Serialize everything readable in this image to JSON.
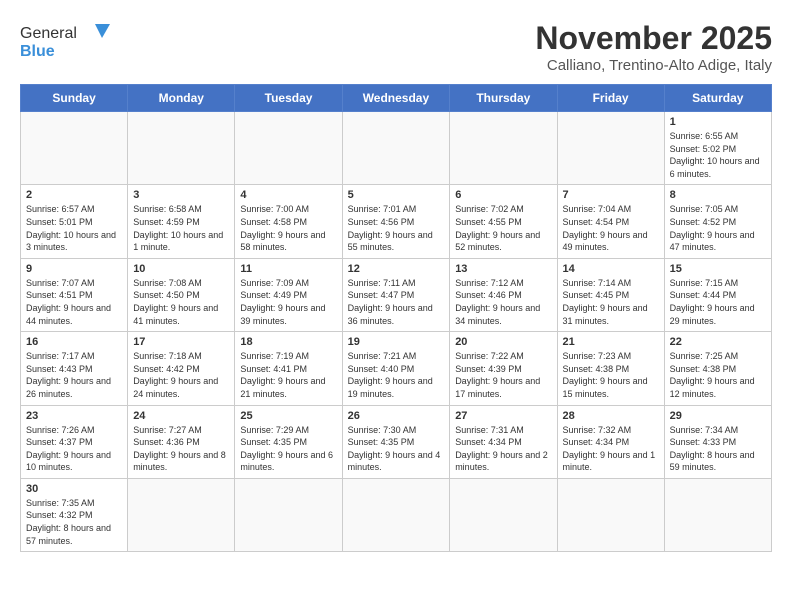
{
  "logo": {
    "text_general": "General",
    "text_blue": "Blue"
  },
  "header": {
    "month": "November 2025",
    "location": "Calliano, Trentino-Alto Adige, Italy"
  },
  "weekdays": [
    "Sunday",
    "Monday",
    "Tuesday",
    "Wednesday",
    "Thursday",
    "Friday",
    "Saturday"
  ],
  "weeks": [
    [
      {
        "day": "",
        "info": ""
      },
      {
        "day": "",
        "info": ""
      },
      {
        "day": "",
        "info": ""
      },
      {
        "day": "",
        "info": ""
      },
      {
        "day": "",
        "info": ""
      },
      {
        "day": "",
        "info": ""
      },
      {
        "day": "1",
        "info": "Sunrise: 6:55 AM\nSunset: 5:02 PM\nDaylight: 10 hours and 6 minutes."
      }
    ],
    [
      {
        "day": "2",
        "info": "Sunrise: 6:57 AM\nSunset: 5:01 PM\nDaylight: 10 hours and 3 minutes."
      },
      {
        "day": "3",
        "info": "Sunrise: 6:58 AM\nSunset: 4:59 PM\nDaylight: 10 hours and 1 minute."
      },
      {
        "day": "4",
        "info": "Sunrise: 7:00 AM\nSunset: 4:58 PM\nDaylight: 9 hours and 58 minutes."
      },
      {
        "day": "5",
        "info": "Sunrise: 7:01 AM\nSunset: 4:56 PM\nDaylight: 9 hours and 55 minutes."
      },
      {
        "day": "6",
        "info": "Sunrise: 7:02 AM\nSunset: 4:55 PM\nDaylight: 9 hours and 52 minutes."
      },
      {
        "day": "7",
        "info": "Sunrise: 7:04 AM\nSunset: 4:54 PM\nDaylight: 9 hours and 49 minutes."
      },
      {
        "day": "8",
        "info": "Sunrise: 7:05 AM\nSunset: 4:52 PM\nDaylight: 9 hours and 47 minutes."
      }
    ],
    [
      {
        "day": "9",
        "info": "Sunrise: 7:07 AM\nSunset: 4:51 PM\nDaylight: 9 hours and 44 minutes."
      },
      {
        "day": "10",
        "info": "Sunrise: 7:08 AM\nSunset: 4:50 PM\nDaylight: 9 hours and 41 minutes."
      },
      {
        "day": "11",
        "info": "Sunrise: 7:09 AM\nSunset: 4:49 PM\nDaylight: 9 hours and 39 minutes."
      },
      {
        "day": "12",
        "info": "Sunrise: 7:11 AM\nSunset: 4:47 PM\nDaylight: 9 hours and 36 minutes."
      },
      {
        "day": "13",
        "info": "Sunrise: 7:12 AM\nSunset: 4:46 PM\nDaylight: 9 hours and 34 minutes."
      },
      {
        "day": "14",
        "info": "Sunrise: 7:14 AM\nSunset: 4:45 PM\nDaylight: 9 hours and 31 minutes."
      },
      {
        "day": "15",
        "info": "Sunrise: 7:15 AM\nSunset: 4:44 PM\nDaylight: 9 hours and 29 minutes."
      }
    ],
    [
      {
        "day": "16",
        "info": "Sunrise: 7:17 AM\nSunset: 4:43 PM\nDaylight: 9 hours and 26 minutes."
      },
      {
        "day": "17",
        "info": "Sunrise: 7:18 AM\nSunset: 4:42 PM\nDaylight: 9 hours and 24 minutes."
      },
      {
        "day": "18",
        "info": "Sunrise: 7:19 AM\nSunset: 4:41 PM\nDaylight: 9 hours and 21 minutes."
      },
      {
        "day": "19",
        "info": "Sunrise: 7:21 AM\nSunset: 4:40 PM\nDaylight: 9 hours and 19 minutes."
      },
      {
        "day": "20",
        "info": "Sunrise: 7:22 AM\nSunset: 4:39 PM\nDaylight: 9 hours and 17 minutes."
      },
      {
        "day": "21",
        "info": "Sunrise: 7:23 AM\nSunset: 4:38 PM\nDaylight: 9 hours and 15 minutes."
      },
      {
        "day": "22",
        "info": "Sunrise: 7:25 AM\nSunset: 4:38 PM\nDaylight: 9 hours and 12 minutes."
      }
    ],
    [
      {
        "day": "23",
        "info": "Sunrise: 7:26 AM\nSunset: 4:37 PM\nDaylight: 9 hours and 10 minutes."
      },
      {
        "day": "24",
        "info": "Sunrise: 7:27 AM\nSunset: 4:36 PM\nDaylight: 9 hours and 8 minutes."
      },
      {
        "day": "25",
        "info": "Sunrise: 7:29 AM\nSunset: 4:35 PM\nDaylight: 9 hours and 6 minutes."
      },
      {
        "day": "26",
        "info": "Sunrise: 7:30 AM\nSunset: 4:35 PM\nDaylight: 9 hours and 4 minutes."
      },
      {
        "day": "27",
        "info": "Sunrise: 7:31 AM\nSunset: 4:34 PM\nDaylight: 9 hours and 2 minutes."
      },
      {
        "day": "28",
        "info": "Sunrise: 7:32 AM\nSunset: 4:34 PM\nDaylight: 9 hours and 1 minute."
      },
      {
        "day": "29",
        "info": "Sunrise: 7:34 AM\nSunset: 4:33 PM\nDaylight: 8 hours and 59 minutes."
      }
    ],
    [
      {
        "day": "30",
        "info": "Sunrise: 7:35 AM\nSunset: 4:32 PM\nDaylight: 8 hours and 57 minutes."
      },
      {
        "day": "",
        "info": ""
      },
      {
        "day": "",
        "info": ""
      },
      {
        "day": "",
        "info": ""
      },
      {
        "day": "",
        "info": ""
      },
      {
        "day": "",
        "info": ""
      },
      {
        "day": "",
        "info": ""
      }
    ]
  ]
}
